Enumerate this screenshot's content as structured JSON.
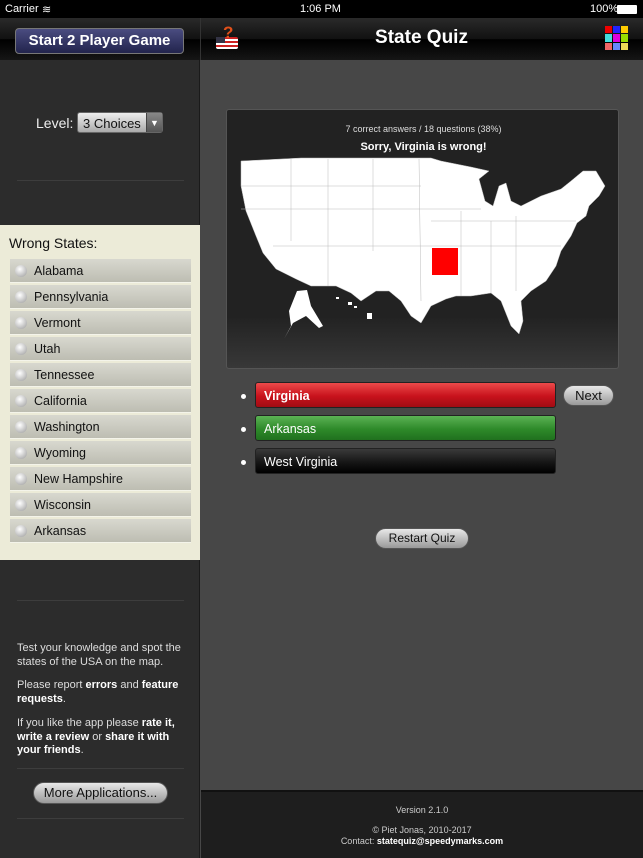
{
  "status": {
    "carrier": "Carrier",
    "time": "1:06 PM",
    "battery": "100%"
  },
  "header": {
    "two_player_label": "Start 2 Player Game",
    "title": "State Quiz",
    "logo_icon": "us-flag-question-icon",
    "menu_icon": "color-grid-icon"
  },
  "level": {
    "label": "Level:",
    "value": "3 Choices"
  },
  "wrong_states": {
    "title": "Wrong States:",
    "items": [
      "Alabama",
      "Pennsylvania",
      "Vermont",
      "Utah",
      "Tennessee",
      "California",
      "Washington",
      "Wyoming",
      "New Hampshire",
      "Wisconsin",
      "Arkansas"
    ]
  },
  "info": {
    "p1": "Test your knowledge and spot the states of the USA on the map.",
    "p2a": "Please report ",
    "p2b": "errors",
    "p2c": " and ",
    "p2d": "feature requests",
    "p2e": ".",
    "p3a": "If you like the app please ",
    "p3b": "rate it, write a review",
    "p3c": " or ",
    "p3d": "share it with your friends",
    "p3e": "."
  },
  "more_apps_label": "More Applications...",
  "quiz": {
    "score": "7 correct answers / 18 questions (38%)",
    "message": "Sorry, Virginia is wrong!",
    "highlighted_state": "Arkansas",
    "highlight_color": "#ff0000",
    "answers": [
      {
        "label": "Virginia",
        "state": "wrong",
        "color": "#d2141e"
      },
      {
        "label": "Arkansas",
        "state": "correct",
        "color": "#2e8a2a"
      },
      {
        "label": "West Virginia",
        "state": "neutral",
        "color": "#1a1a1a"
      }
    ],
    "next_label": "Next",
    "restart_label": "Restart Quiz"
  },
  "footer": {
    "version": "Version 2.1.0",
    "copyright": "© Piet Jonas, 2010-2017",
    "contact_label": "Contact: ",
    "contact_email": "statequiz@speedymarks.com"
  }
}
